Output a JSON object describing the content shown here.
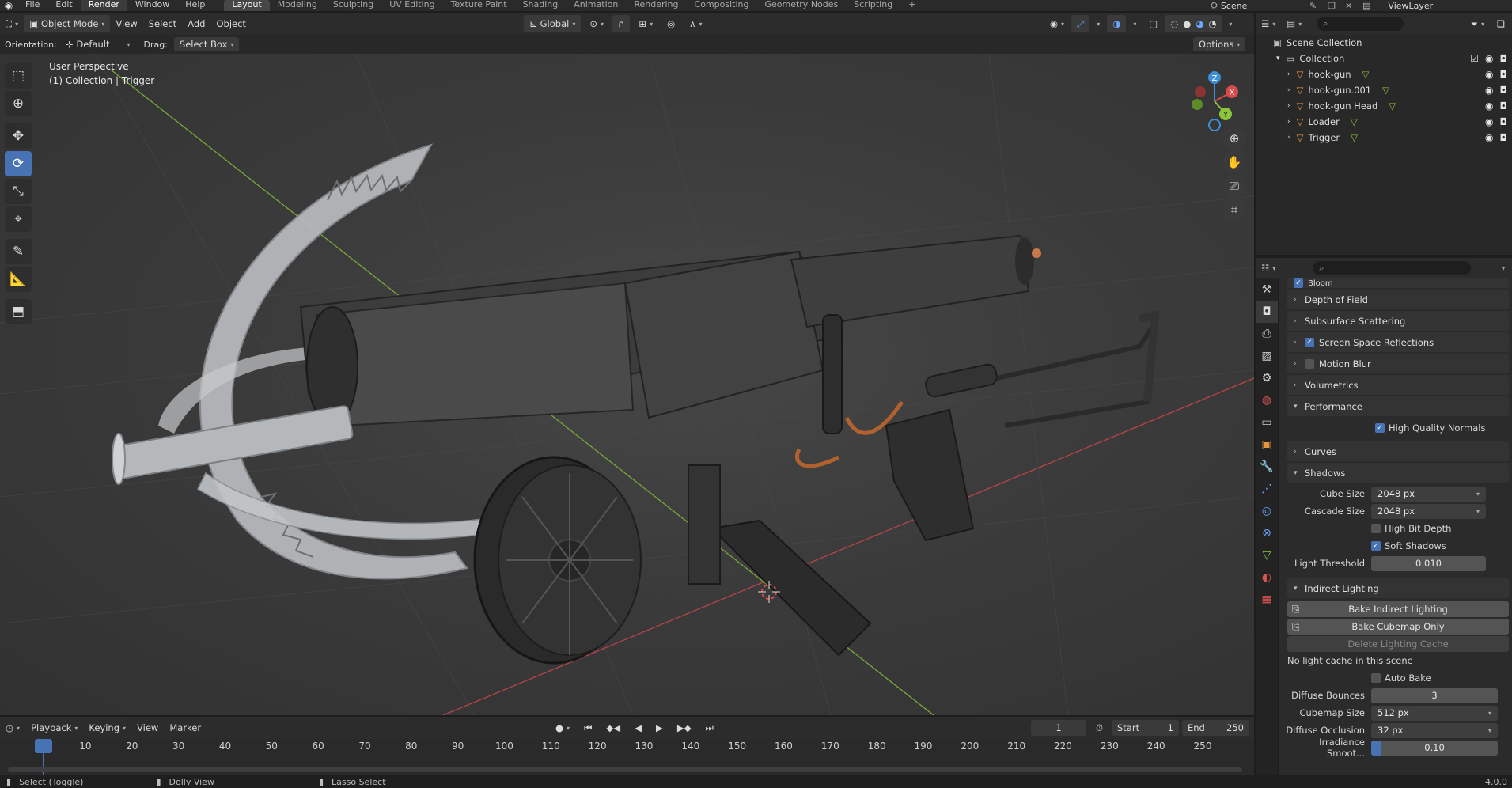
{
  "topbar": {
    "menus": [
      "File",
      "Edit",
      "Render",
      "Window",
      "Help"
    ],
    "active_menu": "Render",
    "workspaces": [
      "Layout",
      "Modeling",
      "Sculpting",
      "UV Editing",
      "Texture Paint",
      "Shading",
      "Animation",
      "Rendering",
      "Compositing",
      "Geometry Nodes",
      "Scripting"
    ],
    "active_workspace": "Layout",
    "add_tab": "+",
    "scene": "Scene",
    "view_layer": "ViewLayer"
  },
  "viewport_header": {
    "mode": "Object Mode",
    "menus": [
      "View",
      "Select",
      "Add",
      "Object"
    ],
    "transform": "Global"
  },
  "tool_header": {
    "orientation_label": "Orientation:",
    "orientation_value": "Default",
    "drag_label": "Drag:",
    "drag_value": "Select Box",
    "options": "Options"
  },
  "viewport": {
    "view_name": "User Perspective",
    "collection_info": "(1) Collection | Trigger",
    "gizmo": {
      "z": "Z",
      "y": "Y",
      "x": "X"
    }
  },
  "toolbar": {
    "tools": [
      "select-box",
      "cursor",
      "move",
      "rotate",
      "scale",
      "transform",
      "annotate",
      "measure",
      "add-cube"
    ],
    "active": "rotate"
  },
  "timeline": {
    "menus": [
      "Playback",
      "Keying",
      "View",
      "Marker"
    ],
    "current_frame": "1",
    "start_label": "Start",
    "start": "1",
    "end_label": "End",
    "end": "250",
    "ticks": [
      "1",
      "10",
      "20",
      "30",
      "40",
      "50",
      "60",
      "70",
      "80",
      "90",
      "100",
      "110",
      "120",
      "130",
      "140",
      "150",
      "160",
      "170",
      "180",
      "190",
      "200",
      "210",
      "220",
      "230",
      "240",
      "250"
    ]
  },
  "statusbar": {
    "hints": [
      "Select (Toggle)",
      "Dolly View",
      "Lasso Select"
    ],
    "version": "4.0.0"
  },
  "outliner": {
    "scene_collection": "Scene Collection",
    "collection": "Collection",
    "items": [
      {
        "name": "hook-gun"
      },
      {
        "name": "hook-gun.001"
      },
      {
        "name": "hook-gun Head"
      },
      {
        "name": "Loader"
      },
      {
        "name": "Trigger"
      }
    ]
  },
  "properties": {
    "partial_top": "Bloom",
    "panels": [
      {
        "label": "Depth of Field",
        "checkbox": null
      },
      {
        "label": "Subsurface Scattering",
        "checkbox": null
      },
      {
        "label": "Screen Space Reflections",
        "checkbox": true
      },
      {
        "label": "Motion Blur",
        "checkbox": false
      },
      {
        "label": "Volumetrics",
        "checkbox": null
      }
    ],
    "performance": {
      "label": "Performance",
      "high_quality_normals": "High Quality Normals"
    },
    "curves": "Curves",
    "shadows": {
      "label": "Shadows",
      "cube_size_label": "Cube Size",
      "cube_size": "2048 px",
      "cascade_size_label": "Cascade Size",
      "cascade_size": "2048 px",
      "high_bit_depth": "High Bit Depth",
      "soft_shadows": "Soft Shadows",
      "light_threshold_label": "Light Threshold",
      "light_threshold": "0.010"
    },
    "indirect_lighting": {
      "label": "Indirect Lighting",
      "bake_indirect": "Bake Indirect Lighting",
      "bake_cubemap": "Bake Cubemap Only",
      "delete_cache": "Delete Lighting Cache",
      "no_cache_msg": "No light cache in this scene",
      "auto_bake": "Auto Bake",
      "diffuse_bounces_label": "Diffuse Bounces",
      "diffuse_bounces": "3",
      "cubemap_size_label": "Cubemap Size",
      "cubemap_size": "512 px",
      "diffuse_occlusion_label": "Diffuse Occlusion",
      "diffuse_occlusion": "32 px",
      "irradiance_smoothing_label": "Irradiance Smoot...",
      "irradiance_smoothing": "0.10"
    }
  },
  "colors": {
    "accent": "#4772b3",
    "x_axis": "#d94a4a",
    "y_axis": "#8cc43c",
    "z_axis": "#3e8ed8",
    "object_icon": "#e8963c"
  }
}
